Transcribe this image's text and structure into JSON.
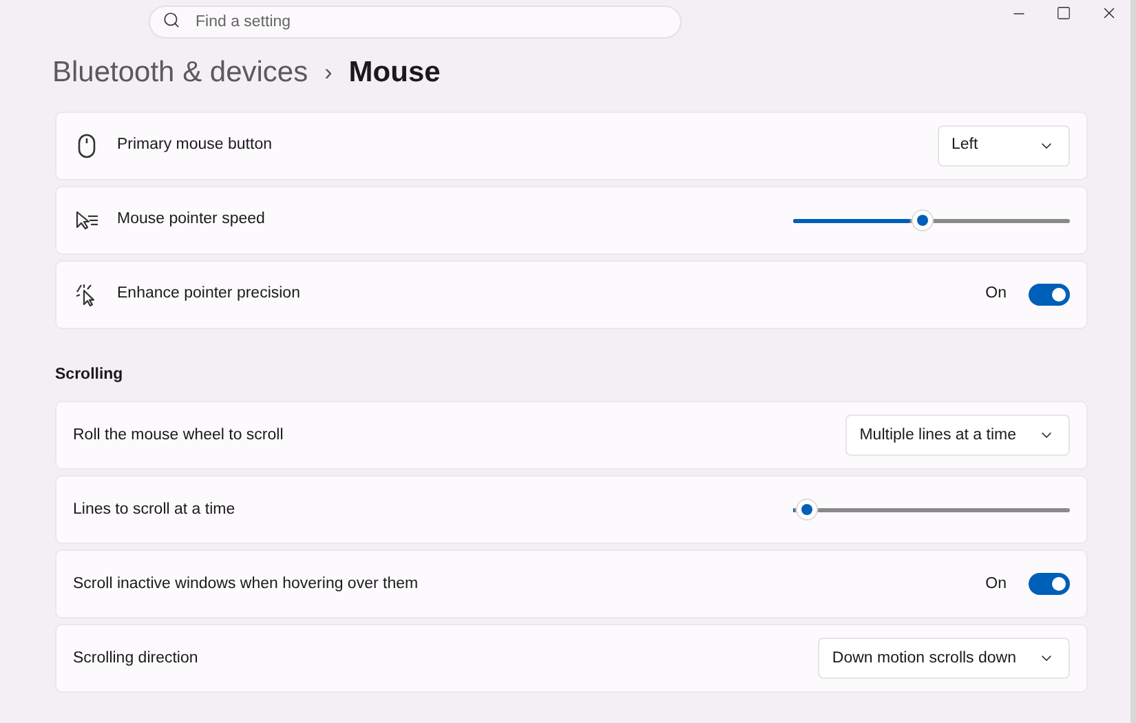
{
  "search": {
    "placeholder": "Find a setting"
  },
  "breadcrumb": {
    "parent": "Bluetooth & devices",
    "separator": "›",
    "current": "Mouse"
  },
  "groups": [
    {
      "rows": [
        {
          "kind": "dropdown",
          "label": "Primary mouse button",
          "value": "Left"
        },
        {
          "kind": "slider",
          "label": "Mouse pointer speed",
          "level": 0.47
        },
        {
          "kind": "toggle",
          "label": "Enhance pointer precision",
          "state_text": "On",
          "on": true
        }
      ]
    },
    {
      "title": "Scrolling",
      "rows": [
        {
          "kind": "dropdown",
          "label": "Roll the mouse wheel to scroll",
          "value": "Multiple lines at a time"
        },
        {
          "kind": "slider",
          "label": "Lines to scroll at a time",
          "level": 0.05
        },
        {
          "kind": "toggle",
          "label": "Scroll inactive windows when hovering over them",
          "state_text": "On",
          "on": true
        },
        {
          "kind": "dropdown",
          "label": "Scrolling direction",
          "value": "Down motion scrolls down"
        }
      ]
    }
  ]
}
